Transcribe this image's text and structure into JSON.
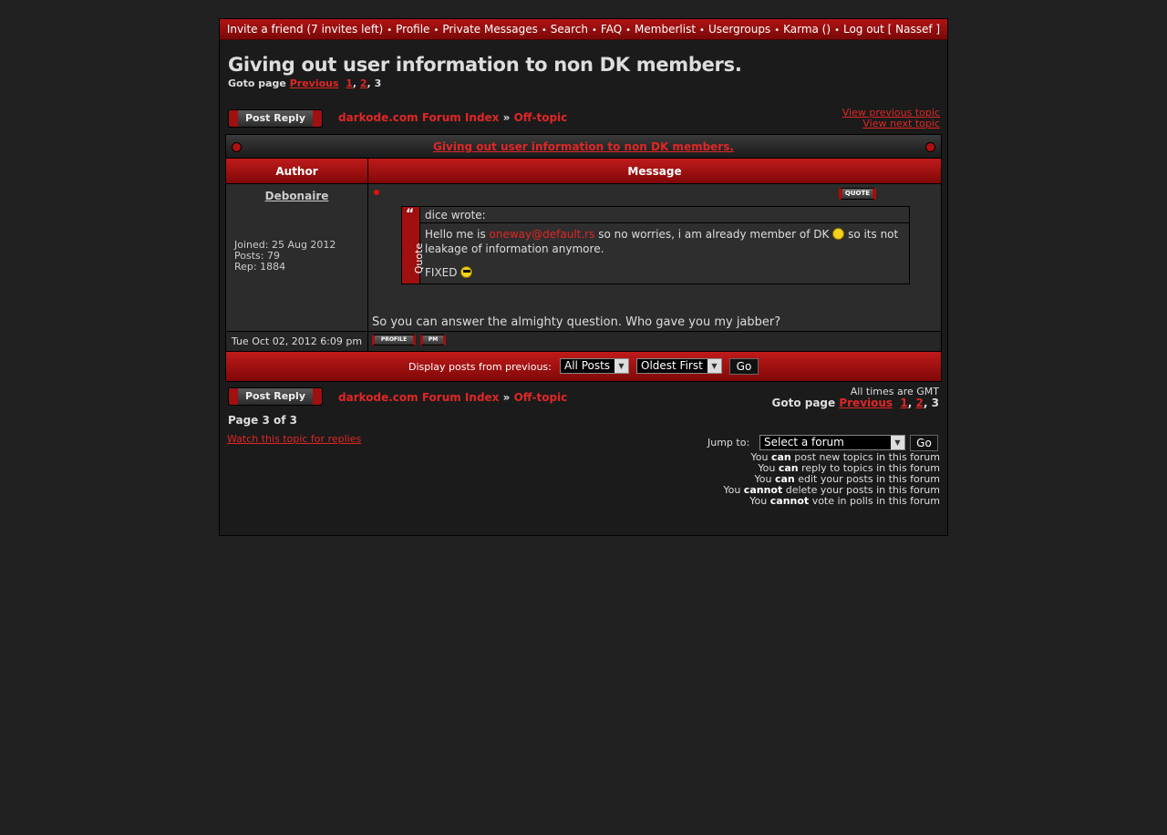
{
  "topnav": {
    "items": [
      "Invite a friend (7 invites left)",
      "Profile",
      "Private Messages",
      "Search",
      "FAQ",
      "Memberlist",
      "Usergroups",
      "Karma ()",
      "Log out [ Nassef ]"
    ]
  },
  "topic": {
    "title": "Giving out user information to non DK members.",
    "goto_label": "Goto page",
    "previous": "Previous",
    "pages": [
      "1",
      "2"
    ],
    "current_page": "3"
  },
  "actions": {
    "post_reply": "Post Reply",
    "forum_index": "darkode.com Forum Index",
    "crumb_sep": "»",
    "subforum": "Off-topic",
    "view_previous": "View previous topic",
    "view_next": "View next topic"
  },
  "table": {
    "title_link": "Giving out user information to non DK members.",
    "col_author": "Author",
    "col_message": "Message"
  },
  "post": {
    "author": "Debonaire",
    "joined": "Joined: 25 Aug 2012",
    "posts": "Posts: 79",
    "rep": "Rep: 1884",
    "quote_btn": "QUOTE",
    "quote_author": "dice wrote:",
    "quote_side": "Quote",
    "quote_line1_a": "Hello me is",
    "quote_email": "oneway@default.rs",
    "quote_line1_b": "so no worries, i am already member of DK",
    "quote_line1_c": "so its not",
    "quote_line2": "leakage of information anymore.",
    "quote_line3": "FIXED",
    "text": "So you can answer the almighty question. Who gave you my jabber?",
    "date": "Tue Oct 02, 2012 6:09 pm",
    "profile_btn": "PROFILE",
    "pm_btn": "PM"
  },
  "display": {
    "label": "Display posts from previous:",
    "filter_value": "All Posts",
    "order_value": "Oldest First",
    "go": "Go"
  },
  "bottom": {
    "timezone": "All times are GMT",
    "page_of": "Page 3 of 3",
    "watch": "Watch this topic for replies",
    "jump_label": "Jump to:",
    "jump_value": "Select a forum",
    "jump_go": "Go"
  },
  "permissions": [
    {
      "pre": "You",
      "verb": "can",
      "post": "post new topics in this forum"
    },
    {
      "pre": "You",
      "verb": "can",
      "post": "reply to topics in this forum"
    },
    {
      "pre": "You",
      "verb": "can",
      "post": "edit your posts in this forum"
    },
    {
      "pre": "You",
      "verb": "cannot",
      "post": "delete your posts in this forum"
    },
    {
      "pre": "You",
      "verb": "cannot",
      "post": "vote in polls in this forum"
    }
  ],
  "colors": {
    "accent": "#e02626",
    "bar": "#b01414",
    "background": "#212121"
  }
}
